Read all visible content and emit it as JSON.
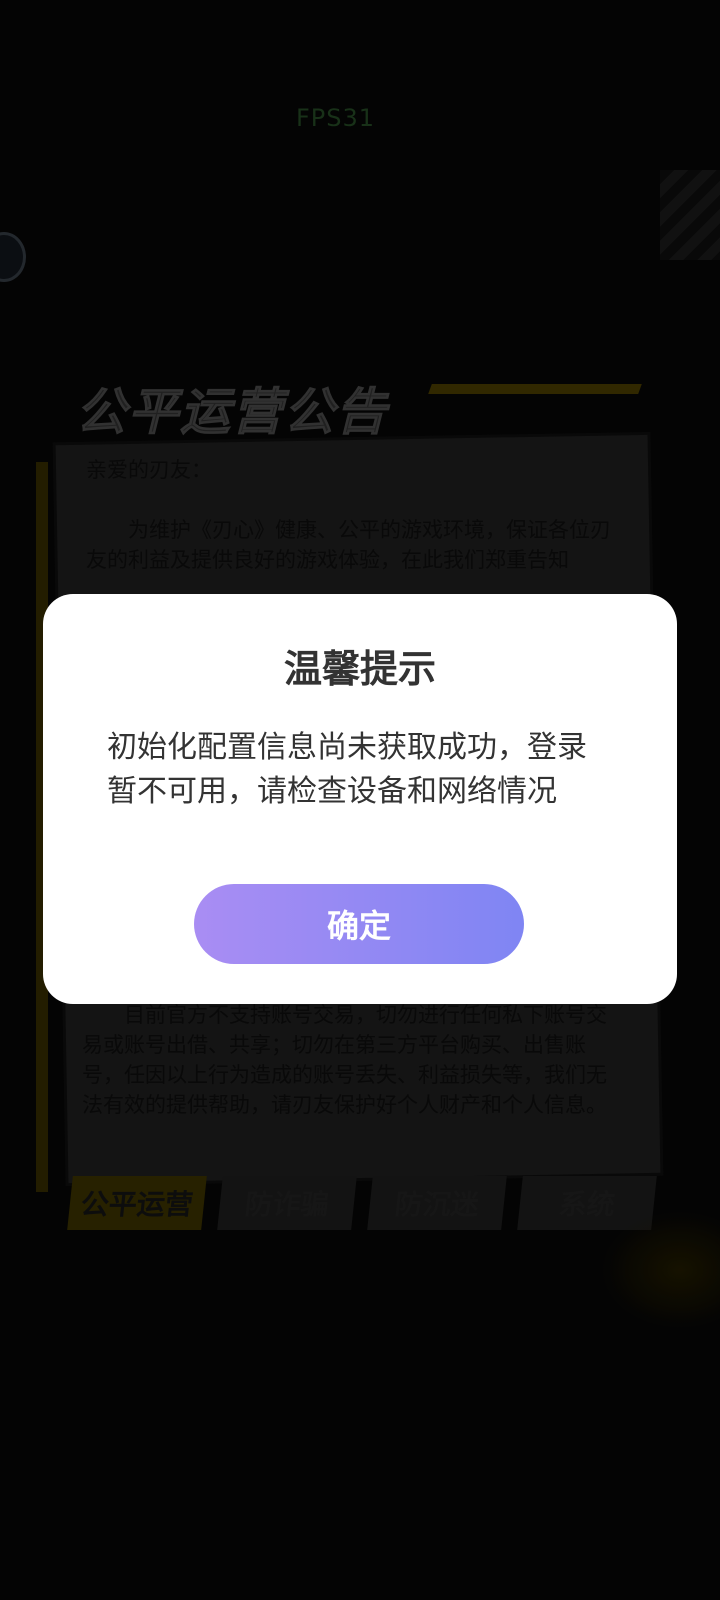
{
  "background": {
    "fps_label": "FPS31",
    "notice_title": "公平运营公告",
    "greeting": "亲爱的刃友：",
    "paragraph_intro": "为维护《刃心》健康、公平的游戏环境，保证各位刃友的利益及提供良好的游戏体验，在此我们郑重告知",
    "paragraph_lower": "目前官方不支持账号交易，切勿进行任何私下账号交易或账号出借、共享；切勿在第三方平台购买、出售账号，任因以上行为造成的账号丢失、利益损失等，我们无法有效的提供帮助，请刃友保护好个人财产和个人信息。",
    "tabs": [
      {
        "label": "公平运营",
        "active": true
      },
      {
        "label": "防诈骗",
        "active": false
      },
      {
        "label": "防沉迷",
        "active": false
      },
      {
        "label": "系统",
        "active": false
      }
    ]
  },
  "dialog": {
    "title": "温馨提示",
    "message": "初始化配置信息尚未获取成功，登录暂不可用，请检查设备和网络情况",
    "confirm_label": "确定"
  },
  "colors": {
    "confirm_gradient_start": "#a98df3",
    "confirm_gradient_end": "#7f85f3",
    "dialog_text": "#333333"
  }
}
